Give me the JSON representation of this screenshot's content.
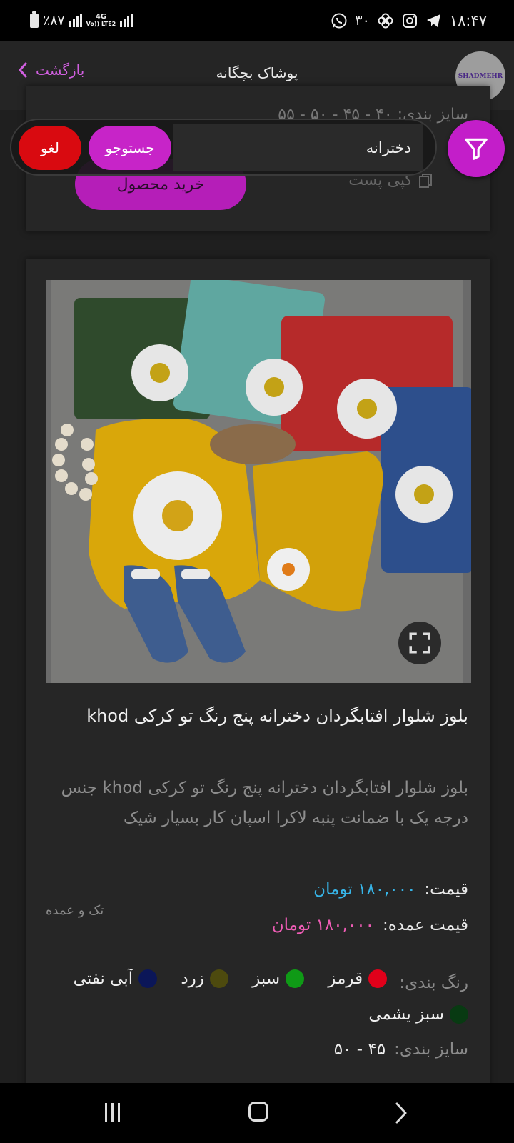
{
  "status_bar": {
    "battery": "٪۸۷",
    "net_top": "4G",
    "net_bottom": "Vo)) LTE2",
    "notification_count": "۳۰",
    "time": "۱۸:۴۷",
    "icons": [
      "battery-icon",
      "signal-icon",
      "whatsapp-icon",
      "pinwheel-icon",
      "instagram-icon",
      "telegram-icon"
    ]
  },
  "header": {
    "back_label": "بازگشت",
    "title": "پوشاک بچگانه",
    "logo_text": "SHADMEHR"
  },
  "previous_card": {
    "size_partial": "سایز بندی:  ۴۰ - ۴۵ - ۵۰ - ۵۵",
    "buy_label": "خرید محصول",
    "copy_label": "کپی پست"
  },
  "search": {
    "value": "دخترانه",
    "search_label": "جستوجو",
    "cancel_label": "لغو"
  },
  "product": {
    "title": "بلوز شلوار افتابگردان دخترانه پنج رنگ تو کرکی khod",
    "description": "بلوز شلوار افتابگردان دخترانه پنج رنگ تو کرکی khod جنس درجه یک با ضمانت پنبه لاکرا اسپان کار بسیار شیک",
    "price_label": "قیمت:",
    "price_value": "۱۸۰,۰۰۰ تومان",
    "wholesale_label": "قیمت عمده:",
    "wholesale_value": "۱۸۰,۰۰۰ تومان",
    "sale_type": "تک و عمده",
    "colors_label": "رنگ بندی:",
    "colors": [
      {
        "name": "قرمز",
        "hex": "#e1001a"
      },
      {
        "name": "سبز",
        "hex": "#0f9a16"
      },
      {
        "name": "زرد",
        "hex": "#4d4a0e"
      },
      {
        "name": "آبی نفتی",
        "hex": "#0b1658"
      },
      {
        "name": "سبز یشمی",
        "hex": "#083a12"
      }
    ],
    "sizes_label": "سایز بندی:",
    "sizes_value": "۴۵ - ۵۰"
  },
  "theme": {
    "accent": "#c31ec9",
    "cancel": "#d90a10",
    "price": "#37b5e8",
    "wholesale": "#ee5cb5"
  }
}
